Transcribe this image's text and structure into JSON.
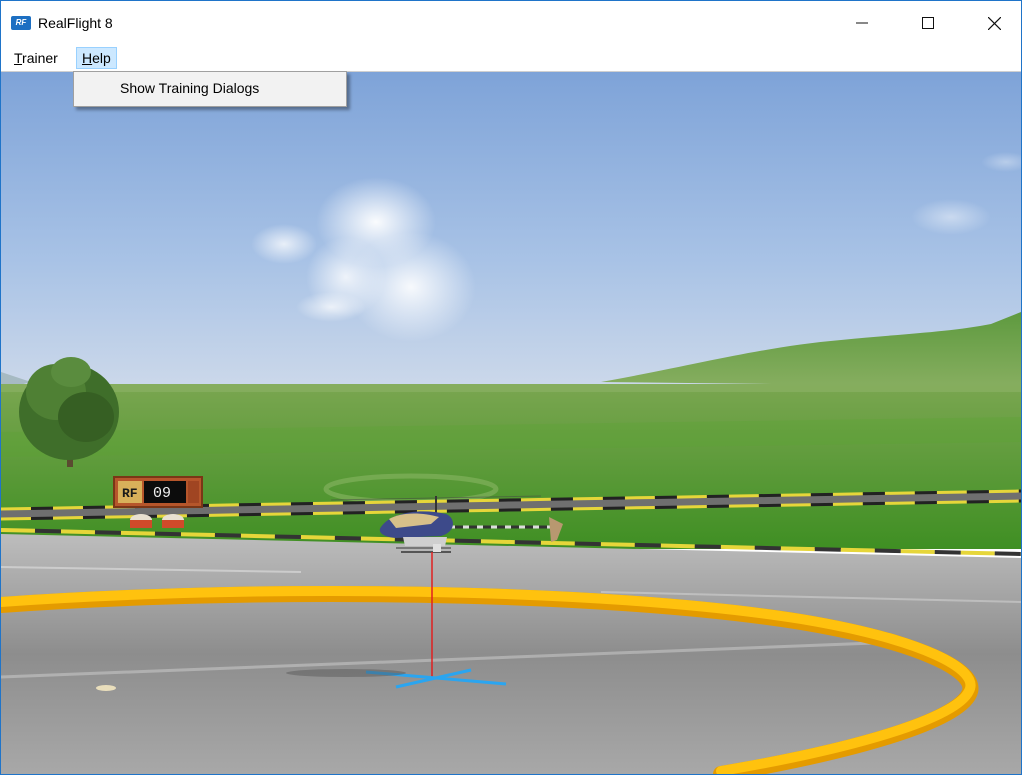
{
  "window": {
    "title": "RealFlight 8",
    "icon": "realflight-logo-icon",
    "icon_text": "RF",
    "controls": [
      "minimize-icon",
      "maximize-icon",
      "close-icon"
    ]
  },
  "menubar": {
    "items": [
      {
        "label": "Trainer",
        "mnemonic": "T"
      },
      {
        "label": "Help",
        "mnemonic": "H",
        "active": true
      }
    ]
  },
  "dropdown": {
    "items": [
      {
        "label": "Show Training Dialogs"
      }
    ]
  },
  "scene": {
    "sign": {
      "logo": "RF",
      "number": "09"
    },
    "colors": {
      "sky": "#8fb1de",
      "grass": "#4f9a2a",
      "runway": "#9a9a9a",
      "pad_ring": "#f5b400",
      "accent": "#1d6fc2"
    }
  }
}
